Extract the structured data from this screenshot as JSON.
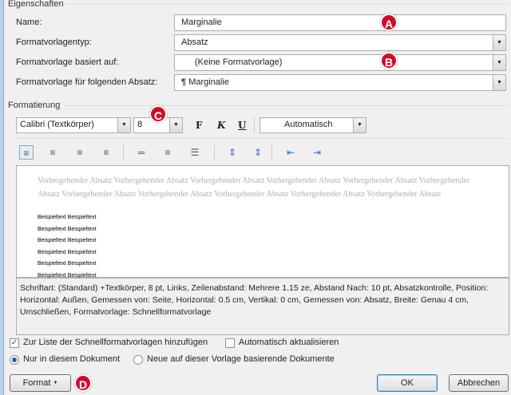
{
  "eigenschaften": {
    "title": "Eigenschaften",
    "name_label": "Name:",
    "name_value": "Marginalie",
    "typ_label": "Formatvorlagentyp:",
    "typ_value": "Absatz",
    "basiert_label": "Formatvorlage basiert auf:",
    "basiert_value": "(Keine Formatvorlage)",
    "folgend_label": "Formatvorlage für folgenden Absatz:",
    "folgend_icon": "¶",
    "folgend_value": "Marginalie"
  },
  "formatierung": {
    "title": "Formatierung",
    "font": "Calibri (Textkörper)",
    "size": "8",
    "bold": "F",
    "italic": "K",
    "underline": "U",
    "color": "Automatisch"
  },
  "preview": {
    "previous": "Vorhergehender Absatz Vorhergehender Absatz Vorhergehender Absatz Vorhergehender Absatz Vorhergehender Absatz Vorhergehender Absatz Vorhergehender Absatz Vorhergehender Absatz Vorhergehender Absatz Vorhergehender Absatz Vorhergehender Absatz",
    "samples": [
      "Beispieltext Beispieltext",
      "Beispieltext Beispieltext",
      "Beispieltext Beispieltext",
      "Beispieltext Beispieltext",
      "Beispieltext Beispieltext",
      "Beispieltext Beispieltext"
    ]
  },
  "description": "Schriftart: (Standard) +Textkörper, 8 pt, Links, Zeilenabstand:  Mehrere 1.15 ze, Abstand Nach:  10 pt, Absatzkontrolle, Position: Horizontal: Außen, Gemessen von: Seite, Horizontal:  0.5 cm, Vertikal:  0 cm, Gemessen von: Absatz, Breite: Genau 4 cm, Umschließen, Formatvorlage: Schnellformatvorlage",
  "options": {
    "add_quick": "Zur Liste der Schnellformatvorlagen hinzufügen",
    "add_quick_checked": true,
    "auto_update": "Automatisch aktualisieren",
    "auto_update_checked": false,
    "only_doc": "Nur in diesem Dokument",
    "new_docs": "Neue auf dieser Vorlage basierende Dokumente",
    "selected": "only_doc"
  },
  "buttons": {
    "format": "Format",
    "format_arrow": "▼",
    "ok": "OK",
    "cancel": "Abbrechen"
  },
  "badges": [
    "A",
    "B",
    "C",
    "D"
  ],
  "colors": {
    "badge": "#c8102e"
  }
}
